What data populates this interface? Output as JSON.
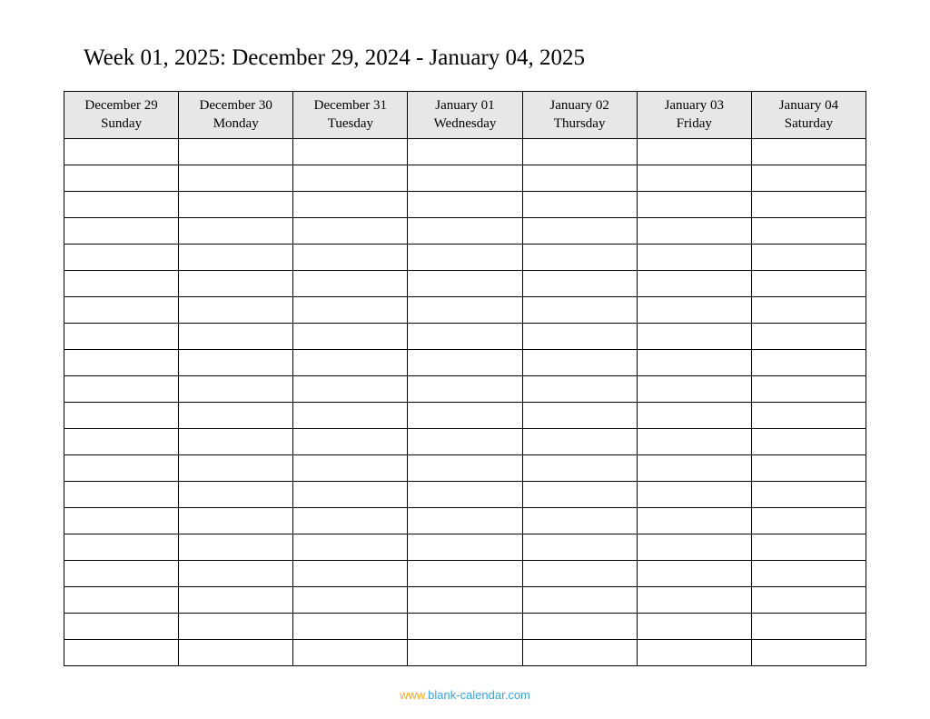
{
  "title": "Week 01, 2025: December 29, 2024 - January 04, 2025",
  "days": [
    {
      "date": "December 29",
      "dow": "Sunday"
    },
    {
      "date": "December 30",
      "dow": "Monday"
    },
    {
      "date": "December 31",
      "dow": "Tuesday"
    },
    {
      "date": "January 01",
      "dow": "Wednesday"
    },
    {
      "date": "January 02",
      "dow": "Thursday"
    },
    {
      "date": "January 03",
      "dow": "Friday"
    },
    {
      "date": "January 04",
      "dow": "Saturday"
    }
  ],
  "row_count": 20,
  "footer": {
    "prefix": "www.",
    "domain": "blank-calendar.com"
  }
}
